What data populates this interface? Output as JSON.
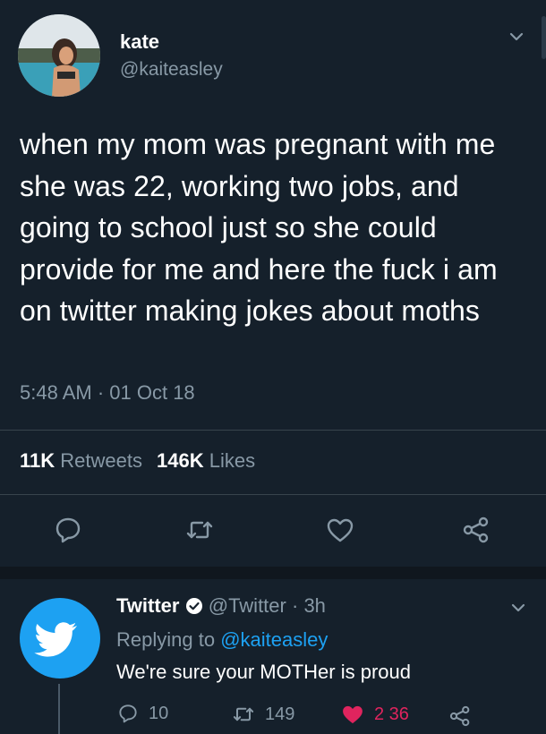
{
  "tweet": {
    "display_name": "kate",
    "handle": "@kaiteasley",
    "text": "when my mom was pregnant with me she was 22, working two jobs, and going to school just so she could provide for me and here the fuck i am on twitter making jokes about moths",
    "timestamp": "5:48 AM · 01 Oct 18",
    "retweets_count": "11K",
    "retweets_label": "Retweets",
    "likes_count": "146K",
    "likes_label": "Likes",
    "actions": [
      "reply-icon",
      "retweet-icon",
      "like-icon",
      "share-icon"
    ]
  },
  "reply": {
    "display_name": "Twitter",
    "handle": "@Twitter",
    "separator": "·",
    "time": "3h",
    "replying_prefix": "Replying to",
    "replying_handle": "@kaiteasley",
    "text": "We're sure your MOTHer is proud",
    "reply_count": "10",
    "retweet_count": "149",
    "like_count": "2 36"
  },
  "colors": {
    "background": "#15202b",
    "accent": "#1da1f2",
    "like": "#e0245e",
    "muted": "#8899a6"
  }
}
